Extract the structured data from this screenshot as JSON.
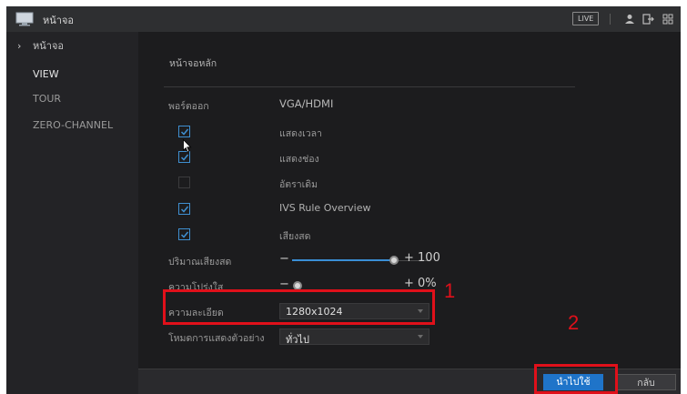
{
  "topbar": {
    "title": "หน้าจอ",
    "live_badge": "LIVE"
  },
  "sidebar": {
    "items": [
      {
        "label": "หน้าจอ",
        "active": true
      },
      {
        "label": "VIEW"
      },
      {
        "label": "TOUR"
      },
      {
        "label": "ZERO-CHANNEL"
      }
    ]
  },
  "main": {
    "section_title": "หน้าจอหลัก",
    "output_port": {
      "label": "พอร์ตออก",
      "value": "VGA/HDMI"
    },
    "checkboxes": [
      {
        "label": "แสดงเวลา",
        "checked": true
      },
      {
        "label": "แสดงช่อง",
        "checked": true
      },
      {
        "label": "อัตราเดิม",
        "checked": false
      },
      {
        "label": "IVS Rule Overview",
        "checked": true
      },
      {
        "label": "เสียงสด",
        "checked": true
      }
    ],
    "volume": {
      "label": "ปริมาณเสียงสด",
      "value": "+ 100",
      "level": 100
    },
    "transparency": {
      "label": "ความโปร่งใส",
      "value": "+ 0%",
      "level": 0
    },
    "resolution": {
      "label": "ความละเอียด",
      "value": "1280x1024"
    },
    "preview_mode": {
      "label": "โหมดการแสดงตัวอย่าง",
      "value": "ทั่วไป"
    }
  },
  "annotations": {
    "marker_1": "1",
    "marker_2": "2"
  },
  "footer": {
    "apply_label": "นำไปใช้",
    "back_label": "กลับ"
  },
  "colors": {
    "accent": "#1f74c9",
    "annotation": "#e0101a",
    "background": "#1c1c1e"
  }
}
